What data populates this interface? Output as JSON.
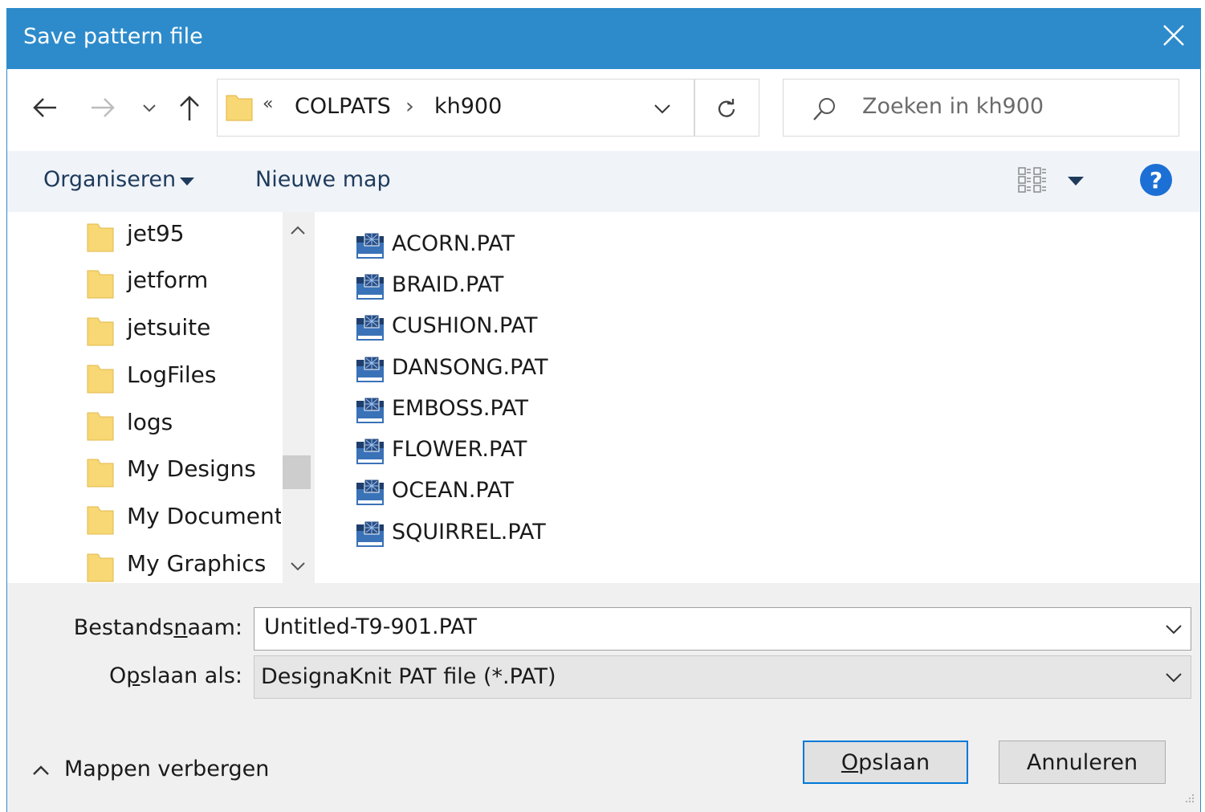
{
  "window": {
    "title": "Save pattern file"
  },
  "nav": {
    "breadcrumb": {
      "overflow": "«",
      "segments": [
        "COLPATS",
        "kh900"
      ],
      "separator": "›"
    },
    "search": {
      "placeholder": "Zoeken in kh900"
    }
  },
  "toolbar": {
    "organize_label": "Organiseren",
    "new_folder_label": "Nieuwe map",
    "help_label": "?"
  },
  "folders": [
    "jet95",
    "jetform",
    "jetsuite",
    "LogFiles",
    "logs",
    "My Designs",
    "My Document:",
    "My Graphics"
  ],
  "files": [
    "ACORN.PAT",
    "BRAID.PAT",
    "CUSHION.PAT",
    "DANSONG.PAT",
    "EMBOSS.PAT",
    "FLOWER.PAT",
    "OCEAN.PAT",
    "SQUIRREL.PAT"
  ],
  "form": {
    "filename_label_pre": "Bestands",
    "filename_label_key": "n",
    "filename_label_post": "aam:",
    "filename_value": "Untitled-T9-901.PAT",
    "savetype_label_pre": "O",
    "savetype_label_key": "p",
    "savetype_label_post": "slaan als:",
    "savetype_value": "DesignaKnit PAT file (*.PAT)"
  },
  "buttons": {
    "save_key": "O",
    "save_rest": "pslaan",
    "cancel": "Annuleren",
    "hide_folders": "Mappen verbergen"
  },
  "colors": {
    "titlebar": "#2d8bcb",
    "accent": "#0078d7",
    "folder": "#f8d775",
    "help": "#1c6fd4"
  }
}
